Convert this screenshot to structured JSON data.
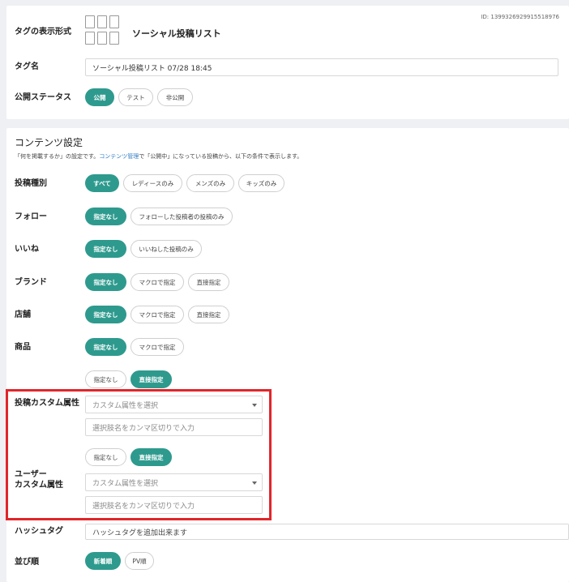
{
  "tag_display": {
    "label": "タグの表示形式",
    "id_text": "ID: 1399326929915518976",
    "format_name": "ソーシャル投稿リスト",
    "format_icon": "grid-layout-icon"
  },
  "tag_name": {
    "label": "タグ名",
    "value": "ソーシャル投稿リスト 07/28 18:45"
  },
  "status": {
    "label": "公開ステータス",
    "options": [
      "公開",
      "テスト",
      "非公開"
    ],
    "selected": "公開"
  },
  "content": {
    "title": "コンテンツ設定",
    "desc_prefix": "「何を掲載するか」の設定です。",
    "desc_link": "コンテンツ管理",
    "desc_suffix": "で「公開中」になっている投稿から、以下の条件で表示します。"
  },
  "post_type": {
    "label": "投稿種別",
    "options": [
      "すべて",
      "レディースのみ",
      "メンズのみ",
      "キッズのみ"
    ],
    "selected": "すべて"
  },
  "follow": {
    "label": "フォロー",
    "options": [
      "指定なし",
      "フォローした投稿者の投稿のみ"
    ],
    "selected": "指定なし"
  },
  "like": {
    "label": "いいね",
    "options": [
      "指定なし",
      "いいねした投稿のみ"
    ],
    "selected": "指定なし"
  },
  "brand": {
    "label": "ブランド",
    "options": [
      "指定なし",
      "マクロで指定",
      "直接指定"
    ],
    "selected": "指定なし"
  },
  "store": {
    "label": "店舗",
    "options": [
      "指定なし",
      "マクロで指定",
      "直接指定"
    ],
    "selected": "指定なし"
  },
  "product": {
    "label": "商品",
    "options": [
      "指定なし",
      "マクロで指定"
    ],
    "selected": "指定なし"
  },
  "post_custom": {
    "label": "投稿カスタム属性",
    "options": [
      "指定なし",
      "直接指定"
    ],
    "selected": "直接指定",
    "select_placeholder": "カスタム属性を選択",
    "input_placeholder": "選択肢名をカンマ区切りで入力"
  },
  "user_custom": {
    "label_line1": "ユーザー",
    "label_line2": "カスタム属性",
    "options": [
      "指定なし",
      "直接指定"
    ],
    "selected": "直接指定",
    "select_placeholder": "カスタム属性を選択",
    "input_placeholder": "選択肢名をカンマ区切りで入力"
  },
  "hashtag": {
    "label": "ハッシュタグ",
    "placeholder": "ハッシュタグを追加出来ます"
  },
  "sort": {
    "label": "並び順",
    "options": [
      "新着順",
      "PV順"
    ],
    "selected": "新着順"
  },
  "colors": {
    "accent": "#2e9a8e",
    "highlight_box": "#e0262b",
    "link": "#2d7bc4"
  }
}
